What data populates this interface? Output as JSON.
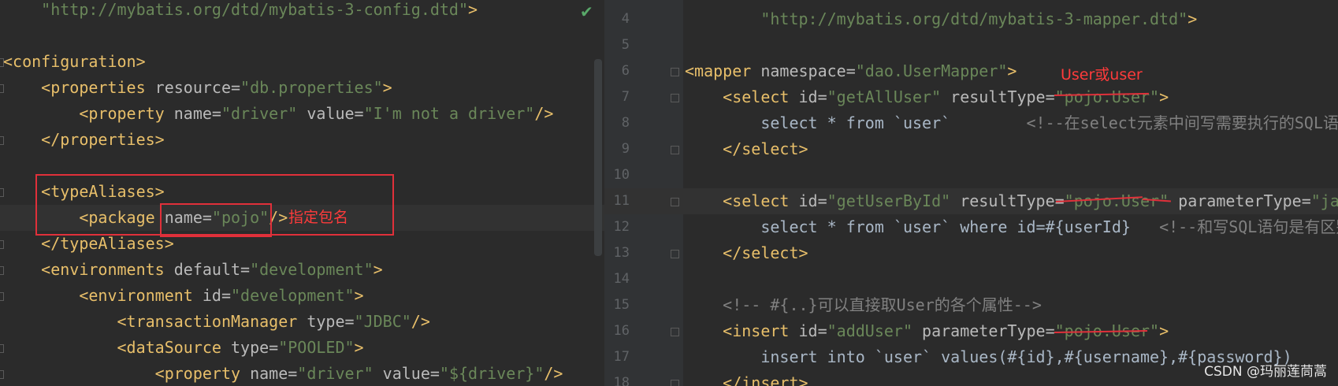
{
  "left_editor": {
    "lines": [
      {
        "indent": "    ",
        "parts": [
          {
            "t": "str",
            "v": "\"http://mybatis.org/dtd/mybatis-3-config.dtd\""
          },
          {
            "t": "tag",
            "v": ">"
          }
        ]
      },
      {
        "indent": "",
        "parts": []
      },
      {
        "indent": "",
        "parts": [
          {
            "t": "tag",
            "v": "<configuration>"
          }
        ]
      },
      {
        "indent": "    ",
        "parts": [
          {
            "t": "tag",
            "v": "<properties "
          },
          {
            "t": "attr",
            "v": "resource="
          },
          {
            "t": "str",
            "v": "\"db.properties\""
          },
          {
            "t": "tag",
            "v": ">"
          }
        ]
      },
      {
        "indent": "        ",
        "parts": [
          {
            "t": "tag",
            "v": "<property "
          },
          {
            "t": "attr",
            "v": "name="
          },
          {
            "t": "str",
            "v": "\"driver\""
          },
          {
            "t": "attr",
            "v": " value="
          },
          {
            "t": "str",
            "v": "\"I'm not a driver\""
          },
          {
            "t": "tag",
            "v": "/>"
          }
        ]
      },
      {
        "indent": "    ",
        "parts": [
          {
            "t": "tag",
            "v": "</properties>"
          }
        ]
      },
      {
        "indent": "",
        "parts": []
      },
      {
        "indent": "    ",
        "parts": [
          {
            "t": "tag",
            "v": "<typeAliases>"
          }
        ]
      },
      {
        "indent": "        ",
        "parts": [
          {
            "t": "tag",
            "v": "<package "
          },
          {
            "t": "attr",
            "v": "name="
          },
          {
            "t": "str",
            "v": "\"pojo\""
          },
          {
            "t": "tag",
            "v": "/>"
          }
        ]
      },
      {
        "indent": "    ",
        "parts": [
          {
            "t": "tag",
            "v": "</typeAliases>"
          }
        ]
      },
      {
        "indent": "    ",
        "parts": [
          {
            "t": "tag",
            "v": "<environments "
          },
          {
            "t": "attr",
            "v": "default="
          },
          {
            "t": "str",
            "v": "\"development\""
          },
          {
            "t": "tag",
            "v": ">"
          }
        ]
      },
      {
        "indent": "        ",
        "parts": [
          {
            "t": "tag",
            "v": "<environment "
          },
          {
            "t": "attr",
            "v": "id="
          },
          {
            "t": "str",
            "v": "\"development\""
          },
          {
            "t": "tag",
            "v": ">"
          }
        ]
      },
      {
        "indent": "            ",
        "parts": [
          {
            "t": "tag",
            "v": "<transactionManager "
          },
          {
            "t": "attr",
            "v": "type="
          },
          {
            "t": "str",
            "v": "\"JDBC\""
          },
          {
            "t": "tag",
            "v": "/>"
          }
        ]
      },
      {
        "indent": "            ",
        "parts": [
          {
            "t": "tag",
            "v": "<dataSource "
          },
          {
            "t": "attr",
            "v": "type="
          },
          {
            "t": "str",
            "v": "\"POOLED\""
          },
          {
            "t": "tag",
            "v": ">"
          }
        ]
      },
      {
        "indent": "                ",
        "parts": [
          {
            "t": "tag",
            "v": "<property "
          },
          {
            "t": "attr",
            "v": "name="
          },
          {
            "t": "str",
            "v": "\"driver\""
          },
          {
            "t": "attr",
            "v": " value="
          },
          {
            "t": "str",
            "v": "\"${driver}\""
          },
          {
            "t": "tag",
            "v": "/>"
          }
        ]
      }
    ],
    "annotation": "指定包名"
  },
  "right_editor": {
    "lines": [
      {
        "num": "4",
        "indent": "        ",
        "parts": [
          {
            "t": "str",
            "v": "\"http://mybatis.org/dtd/mybatis-3-mapper.dtd\""
          },
          {
            "t": "tag",
            "v": ">"
          }
        ]
      },
      {
        "num": "5",
        "indent": "",
        "parts": []
      },
      {
        "num": "6",
        "indent": "",
        "parts": [
          {
            "t": "tag",
            "v": "<mapper "
          },
          {
            "t": "attr",
            "v": "namespace="
          },
          {
            "t": "str",
            "v": "\"dao.UserMapper\""
          },
          {
            "t": "tag",
            "v": ">"
          }
        ]
      },
      {
        "num": "7",
        "indent": "    ",
        "parts": [
          {
            "t": "tag",
            "v": "<select "
          },
          {
            "t": "attr",
            "v": "id="
          },
          {
            "t": "str",
            "v": "\"getAllUser\""
          },
          {
            "t": "attr",
            "v": " resultType="
          },
          {
            "t": "str",
            "v": "\"pojo.User\""
          },
          {
            "t": "tag",
            "v": ">"
          }
        ]
      },
      {
        "num": "8",
        "indent": "        ",
        "parts": [
          {
            "t": "txt",
            "v": "select * from `user`        "
          },
          {
            "t": "cm",
            "v": "<!--在select元素中间写需要执行的SQL语句"
          }
        ]
      },
      {
        "num": "9",
        "indent": "    ",
        "parts": [
          {
            "t": "tag",
            "v": "</select>"
          }
        ]
      },
      {
        "num": "10",
        "indent": "",
        "parts": []
      },
      {
        "num": "11",
        "indent": "    ",
        "parts": [
          {
            "t": "tag",
            "v": "<select "
          },
          {
            "t": "attr",
            "v": "id="
          },
          {
            "t": "str",
            "v": "\"getUserById\""
          },
          {
            "t": "attr",
            "v": " resultType="
          },
          {
            "t": "str",
            "v": "\"pojo.User\""
          },
          {
            "t": "attr",
            "v": " parameterType="
          },
          {
            "t": "str",
            "v": "\"jav"
          }
        ]
      },
      {
        "num": "12",
        "indent": "        ",
        "parts": [
          {
            "t": "txt",
            "v": "select * from `user` where id=#{userId}   "
          },
          {
            "t": "cm",
            "v": "<!--和写SQL语句是有区别"
          }
        ]
      },
      {
        "num": "13",
        "indent": "    ",
        "parts": [
          {
            "t": "tag",
            "v": "</select>"
          }
        ]
      },
      {
        "num": "14",
        "indent": "",
        "parts": []
      },
      {
        "num": "15",
        "indent": "    ",
        "parts": [
          {
            "t": "cm",
            "v": "<!-- #{..}可以直接取User的各个属性-->"
          }
        ]
      },
      {
        "num": "16",
        "indent": "    ",
        "parts": [
          {
            "t": "tag",
            "v": "<insert "
          },
          {
            "t": "attr",
            "v": "id="
          },
          {
            "t": "str",
            "v": "\"addUser\""
          },
          {
            "t": "attr",
            "v": " parameterType="
          },
          {
            "t": "str",
            "v": "\"pojo.User\""
          },
          {
            "t": "tag",
            "v": ">"
          }
        ]
      },
      {
        "num": "17",
        "indent": "        ",
        "parts": [
          {
            "t": "txt",
            "v": "insert into `user` values(#{id},#{username},#{password})"
          }
        ]
      },
      {
        "num": "18",
        "indent": "    ",
        "parts": [
          {
            "t": "tag",
            "v": "</insert>"
          }
        ]
      }
    ],
    "annotation": "User或user"
  },
  "watermark": "CSDN @玛丽莲茼蒿",
  "colors": {
    "background": "#2b2b2b",
    "tag": "#e8bf6a",
    "attribute": "#bababa",
    "string": "#6a8759",
    "text": "#a9b7c6",
    "comment": "#808080",
    "annotation_red": "#e0303a",
    "check": "#59a869"
  },
  "icons": {
    "inspection_ok": "check-icon"
  }
}
